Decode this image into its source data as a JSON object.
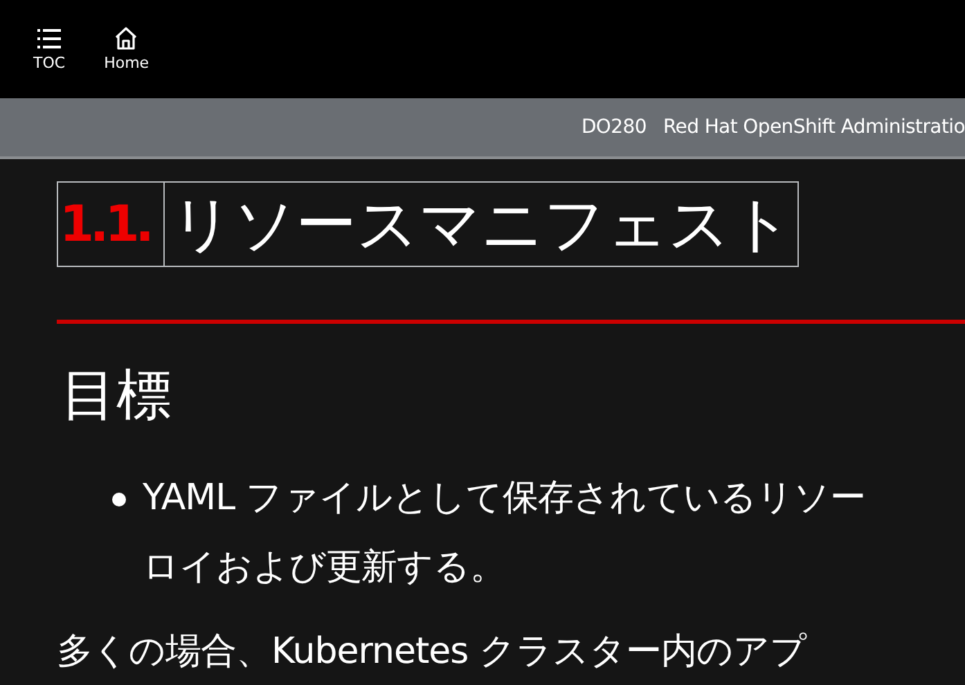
{
  "toolbar": {
    "buttons": [
      {
        "kind": "toc",
        "label": "TOC"
      },
      {
        "kind": "home",
        "label": "Home"
      }
    ]
  },
  "banner": {
    "course": "DO280",
    "title": "Red Hat OpenShift Administratio"
  },
  "section": {
    "number": "1.1.",
    "title": "リソースマニフェスト"
  },
  "objectives": {
    "heading": "目標",
    "items": [
      {
        "lines": [
          "YAML ファイルとして保存されているリソー",
          "ロイおよび更新する。"
        ]
      }
    ]
  },
  "paragraph": "多くの場合、Kubernetes クラスター内のアプ"
}
